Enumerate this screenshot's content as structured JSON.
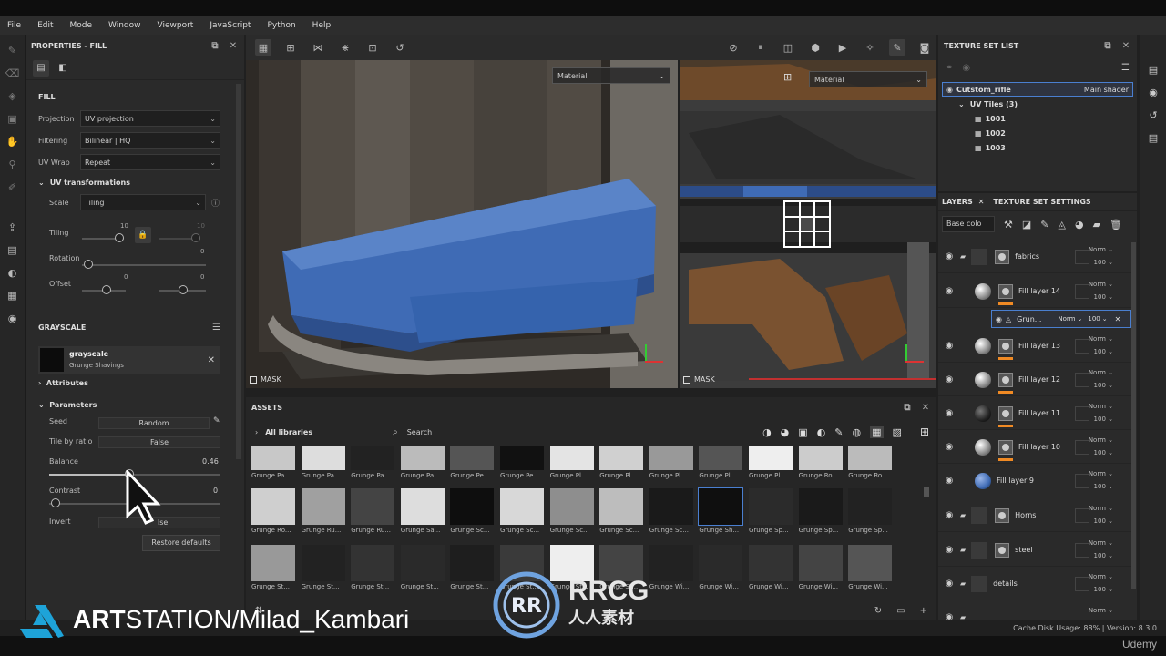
{
  "menu": [
    "File",
    "Edit",
    "Mode",
    "Window",
    "Viewport",
    "JavaScript",
    "Python",
    "Help"
  ],
  "properties": {
    "title": "PROPERTIES - FILL",
    "fill_title": "FILL",
    "projection_label": "Projection",
    "projection_value": "UV projection",
    "filtering_label": "Filtering",
    "filtering_value": "Bilinear | HQ",
    "uvwrap_label": "UV Wrap",
    "uvwrap_value": "Repeat",
    "uvtrans_label": "UV transformations",
    "scale_label": "Scale",
    "scale_value": "Tiling",
    "tiling_label": "Tiling",
    "tiling_value": "10",
    "tiling_value2": "10",
    "rotation_label": "Rotation",
    "rotation_value": "0",
    "offset_label": "Offset",
    "offset_value": "0",
    "offset_value2": "0",
    "grayscale_title": "GRAYSCALE",
    "grayscale_name": "grayscale",
    "grayscale_sub": "Grunge Shavings",
    "attributes_label": "Attributes",
    "parameters_label": "Parameters",
    "seed_label": "Seed",
    "seed_value": "Random",
    "tile_label": "Tile by ratio",
    "tile_value": "False",
    "balance_label": "Balance",
    "balance_value": "0.46",
    "contrast_label": "Contrast",
    "contrast_value": "0",
    "invert_label": "Invert",
    "invert_value": "lse",
    "restore_label": "Restore defaults"
  },
  "viewports": {
    "left_dropdown": "Material",
    "right_dropdown": "Material",
    "mask_left": "MASK",
    "mask_right": "MASK"
  },
  "assets": {
    "title": "ASSETS",
    "library": "All libraries",
    "search_placeholder": "Search",
    "rows": [
      [
        "Grunge Pa...",
        "Grunge Pa...",
        "Grunge Pa...",
        "Grunge Pa...",
        "Grunge Pe...",
        "Grunge Pe...",
        "Grunge Pl...",
        "Grunge Pl...",
        "Grunge Pl...",
        "Grunge Pl...",
        "Grunge Pl...",
        "Grunge Ro...",
        "Grunge Ro..."
      ],
      [
        "Grunge Ro...",
        "Grunge Ru...",
        "Grunge Ru...",
        "Grunge Sa...",
        "Grunge Sc...",
        "Grunge Sc...",
        "Grunge Sc...",
        "Grunge Sc...",
        "Grunge Sc...",
        "Grunge Sh...",
        "Grunge Sp...",
        "Grunge Sp...",
        "Grunge Sp..."
      ],
      [
        "Grunge St...",
        "Grunge St...",
        "Grunge St...",
        "Grunge St...",
        "Grunge St...",
        "Grunge St...",
        "Grunge St...",
        "Grunge St...",
        "Grunge Wi...",
        "Grunge Wi...",
        "Grunge Wi...",
        "Grunge Wi...",
        "Grunge Wi..."
      ]
    ]
  },
  "texture_set_list": {
    "title": "TEXTURE SET LIST",
    "set_name": "Cutstom_rifle",
    "shader": "Main shader",
    "uv_tiles": "UV Tiles (3)",
    "tiles": [
      "1001",
      "1002",
      "1003"
    ]
  },
  "layers": {
    "tab_layers": "LAYERS",
    "tab_tss": "TEXTURE SET SETTINGS",
    "channel": "Base colo",
    "items": [
      {
        "name": "fabrics",
        "blend": "Norm",
        "opacity": "100"
      },
      {
        "name": "Fill layer 14",
        "blend": "Norm",
        "opacity": "100"
      },
      {
        "name": "Grun...",
        "blend": "Norm",
        "opacity": "100"
      },
      {
        "name": "Fill layer 13",
        "blend": "Norm",
        "opacity": "100"
      },
      {
        "name": "Fill layer 12",
        "blend": "Norm",
        "opacity": "100"
      },
      {
        "name": "Fill layer 11",
        "blend": "Norm",
        "opacity": "100"
      },
      {
        "name": "Fill layer 10",
        "blend": "Norm",
        "opacity": "100"
      },
      {
        "name": "Fill layer 9",
        "blend": "Norm",
        "opacity": "100"
      },
      {
        "name": "Horns",
        "blend": "Norm",
        "opacity": "100"
      },
      {
        "name": "steel",
        "blend": "Norm",
        "opacity": "100"
      },
      {
        "name": "details",
        "blend": "Norm",
        "opacity": "100"
      },
      {
        "name": "",
        "blend": "Norm",
        "opacity": "100"
      }
    ]
  },
  "status": {
    "text": "Cache Disk Usage:   88% | Version: 8.3.0"
  },
  "overlay": {
    "artstation_bold": "ART",
    "artstation_rest": "STATION/Milad_Kambari",
    "rrcg_top": "RRCG",
    "rrcg_bottom": "人人素材",
    "udemy": "Udemy"
  },
  "colors": {
    "accent_orange": "#f08a24",
    "blue_fabric": "#3f6bb5",
    "selection_blue": "#4a7fd0"
  }
}
